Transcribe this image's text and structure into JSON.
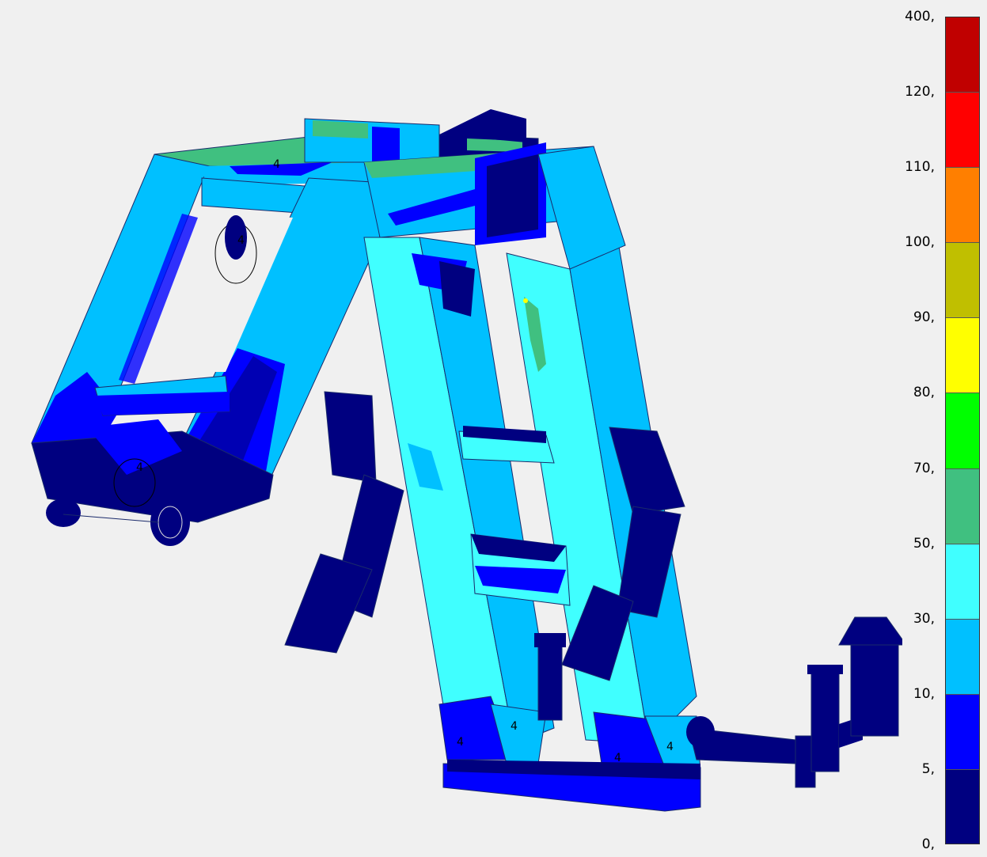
{
  "legend": {
    "bins": [
      {
        "color": "#c00000"
      },
      {
        "color": "#ff0000"
      },
      {
        "color": "#ff7f00"
      },
      {
        "color": "#c0bf00"
      },
      {
        "color": "#ffff00"
      },
      {
        "color": "#00ff00"
      },
      {
        "color": "#40c080"
      },
      {
        "color": "#40ffff"
      },
      {
        "color": "#00c0ff"
      },
      {
        "color": "#0000ff"
      },
      {
        "color": "#000080"
      }
    ],
    "ticks": [
      "400,",
      "120,",
      "110,",
      "100,",
      "90,",
      "80,",
      "70,",
      "50,",
      "30,",
      "10,",
      "5,",
      "0,"
    ]
  },
  "model": {
    "node_marker": "4",
    "colors": {
      "dark": "#000080",
      "blue": "#0000ff",
      "mid": "#00c0ff",
      "cyan": "#40ffff",
      "green": "#40c080",
      "yellow": "#ffff00"
    }
  }
}
